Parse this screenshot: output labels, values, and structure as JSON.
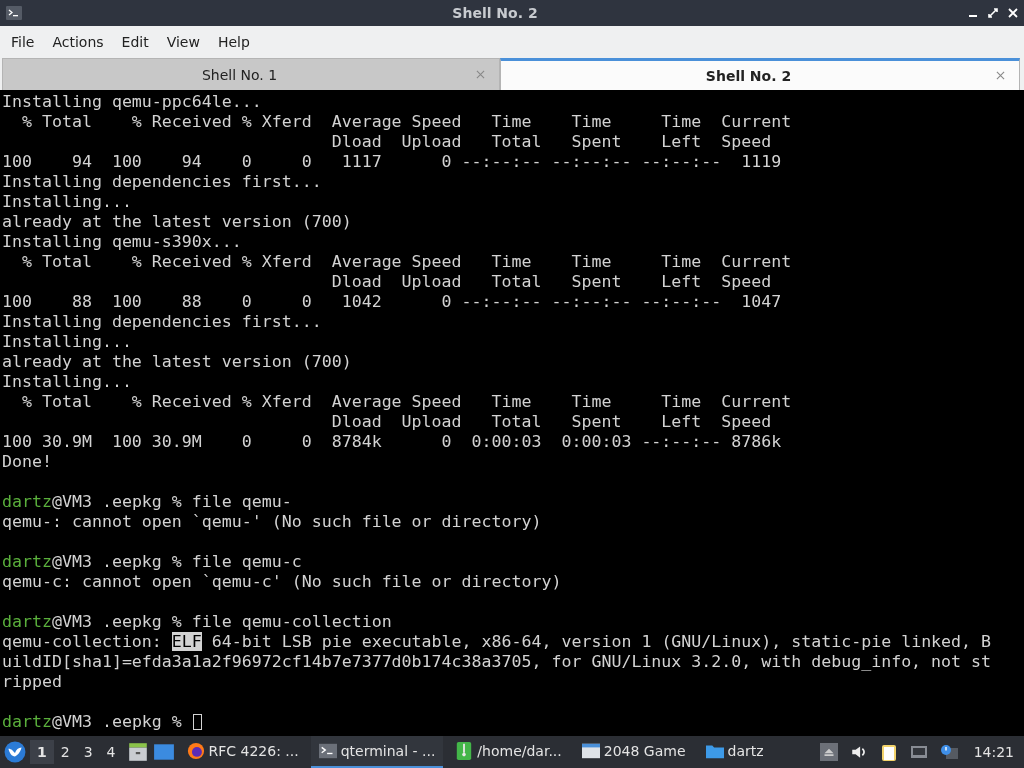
{
  "window": {
    "title": "Shell No. 2"
  },
  "menu": [
    "File",
    "Actions",
    "Edit",
    "View",
    "Help"
  ],
  "tabs": [
    {
      "label": "Shell No. 1",
      "selected": false
    },
    {
      "label": "Shell No. 2",
      "selected": true
    }
  ],
  "terminal": {
    "lines": [
      {
        "kind": "output",
        "text": "Installing qemu-ppc64le..."
      },
      {
        "kind": "output",
        "text": "  % Total    % Received % Xferd  Average Speed   Time    Time     Time  Current"
      },
      {
        "kind": "output",
        "text": "                                 Dload  Upload   Total   Spent    Left  Speed"
      },
      {
        "kind": "output",
        "text": "100    94  100    94    0     0   1117      0 --:--:-- --:--:-- --:--:--  1119"
      },
      {
        "kind": "output",
        "text": "Installing dependencies first..."
      },
      {
        "kind": "output",
        "text": "Installing..."
      },
      {
        "kind": "output",
        "text": "already at the latest version (700)"
      },
      {
        "kind": "output",
        "text": "Installing qemu-s390x..."
      },
      {
        "kind": "output",
        "text": "  % Total    % Received % Xferd  Average Speed   Time    Time     Time  Current"
      },
      {
        "kind": "output",
        "text": "                                 Dload  Upload   Total   Spent    Left  Speed"
      },
      {
        "kind": "output",
        "text": "100    88  100    88    0     0   1042      0 --:--:-- --:--:-- --:--:--  1047"
      },
      {
        "kind": "output",
        "text": "Installing dependencies first..."
      },
      {
        "kind": "output",
        "text": "Installing..."
      },
      {
        "kind": "output",
        "text": "already at the latest version (700)"
      },
      {
        "kind": "output",
        "text": "Installing..."
      },
      {
        "kind": "output",
        "text": "  % Total    % Received % Xferd  Average Speed   Time    Time     Time  Current"
      },
      {
        "kind": "output",
        "text": "                                 Dload  Upload   Total   Spent    Left  Speed"
      },
      {
        "kind": "output",
        "text": "100 30.9M  100 30.9M    0     0  8784k      0  0:00:03  0:00:03 --:--:-- 8786k"
      },
      {
        "kind": "output",
        "text": "Done!"
      },
      {
        "kind": "blank"
      },
      {
        "kind": "prompt",
        "user": "dartz",
        "prompt": "@VM3 .eepkg % ",
        "command": "file qemu-",
        "cursor": false
      },
      {
        "kind": "output",
        "text": "qemu-: cannot open `qemu-' (No such file or directory)"
      },
      {
        "kind": "blank"
      },
      {
        "kind": "prompt",
        "user": "dartz",
        "prompt": "@VM3 .eepkg % ",
        "command": "file qemu-c",
        "cursor": false
      },
      {
        "kind": "output",
        "text": "qemu-c: cannot open `qemu-c' (No such file or directory)"
      },
      {
        "kind": "blank"
      },
      {
        "kind": "prompt",
        "user": "dartz",
        "prompt": "@VM3 .eepkg % ",
        "command": "file qemu-collection",
        "cursor": false
      },
      {
        "kind": "highlight",
        "before": "qemu-collection: ",
        "mark": "ELF",
        "after": " 64-bit LSB pie executable, x86-64, version 1 (GNU/Linux), static-pie linked, B"
      },
      {
        "kind": "output",
        "text": "uildID[sha1]=efda3a1a2f96972cf14b7e7377d0b174c38a3705, for GNU/Linux 3.2.0, with debug_info, not st"
      },
      {
        "kind": "output",
        "text": "ripped"
      },
      {
        "kind": "blank"
      },
      {
        "kind": "prompt",
        "user": "dartz",
        "prompt": "@VM3 .eepkg % ",
        "cursor": true
      }
    ]
  },
  "taskbar": {
    "workspaces": [
      {
        "label": "1",
        "selected": true
      },
      {
        "label": "2",
        "selected": false
      },
      {
        "label": "3",
        "selected": false
      },
      {
        "label": "4",
        "selected": false
      }
    ],
    "tasks": [
      {
        "kind": "browser",
        "label": "RFC 4226: ...",
        "selected": false
      },
      {
        "kind": "terminal",
        "label": "qterminal - ...",
        "selected": true
      },
      {
        "kind": "archive",
        "label": "/home/dar...",
        "selected": false
      },
      {
        "kind": "window",
        "label": "2048 Game",
        "selected": false
      },
      {
        "kind": "folder",
        "label": "dartz",
        "selected": false
      }
    ],
    "clock": "14:21"
  }
}
